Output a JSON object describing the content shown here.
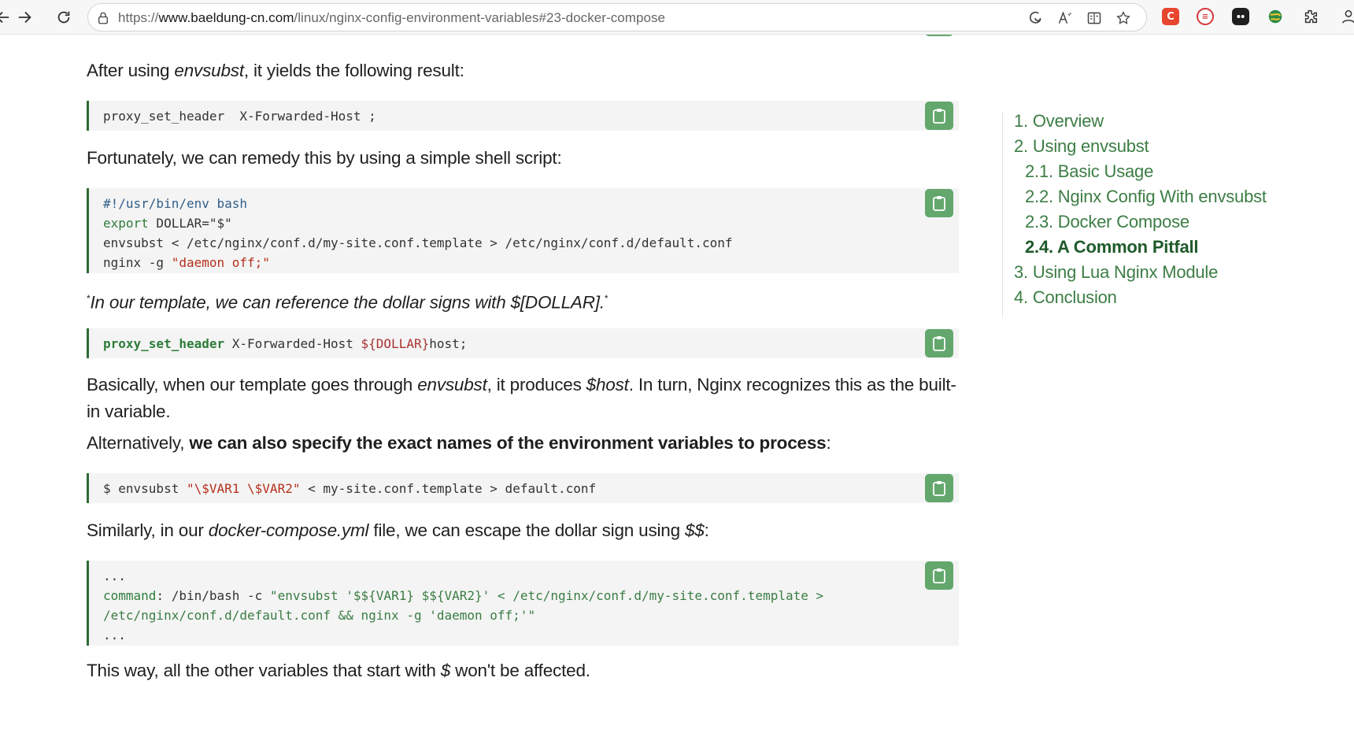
{
  "browser": {
    "url_host_prefix": "https://",
    "url_host": "www.baeldung-cn.com",
    "url_path": "/linux/nginx-config-environment-variables#23-docker-compose"
  },
  "article": {
    "p1": {
      "before": "After using ",
      "em": "envsubst",
      "after": ", it yields the following result:"
    },
    "code1": [
      "proxy_set_header  X-Forwarded-Host ;"
    ],
    "p2": "Fortunately, we can remedy this by using a simple shell script:",
    "code2": {
      "line1": "#!/usr/bin/env bash",
      "line2_kw": "export",
      "line2_rest": " DOLLAR=\"$\"",
      "line3": "envsubst < /etc/nginx/conf.d/my-site.conf.template > /etc/nginx/conf.d/default.conf",
      "line4_a": "nginx -g ",
      "line4_str": "\"daemon off;\""
    },
    "p3": {
      "mark": "*",
      "text": "In our template, we can reference the dollar signs with $[DOLLAR].",
      "end": "*"
    },
    "code3": {
      "kw": "proxy_set_header",
      "mid": " X-Forwarded-Host ",
      "var": "${DOLLAR}",
      "end": "host;"
    },
    "p4": {
      "a": "Basically, when our template goes through ",
      "em1": "envsubst",
      "b": ", it produces ",
      "em2": "$host",
      "c": ". In turn, Nginx recognizes this as the built-in variable."
    },
    "p5": {
      "a": "Alternatively, ",
      "b": "we can also specify the exact names of the environment variables to process",
      "c": ":"
    },
    "code4": {
      "a": "$ envsubst ",
      "str": "\"\\$VAR1 \\$VAR2\"",
      "b": " < my-site.conf.template > default.conf"
    },
    "p6": {
      "a": "Similarly, in our ",
      "em1": "docker-compose.yml",
      "b": " file, we can escape the dollar sign using ",
      "em2": "$$",
      "c": ":"
    },
    "code5": {
      "line1": "...",
      "line2_kw": "command",
      "line2_a": ": /bin/bash -c ",
      "line2_str": "\"envsubst '$${VAR1} $${VAR2}' < /etc/nginx/conf.d/my-site.conf.template >",
      "line3_str": "/etc/nginx/conf.d/default.conf && nginx -g 'daemon off;'\"",
      "line4": "..."
    },
    "p7": {
      "a": "This way, all the other variables that start with ",
      "em": "$",
      "b": " won't be affected."
    }
  },
  "toc": {
    "items": [
      {
        "label": "1. Overview"
      },
      {
        "label": "2. Using envsubst"
      },
      {
        "label": "2.1. Basic Usage"
      },
      {
        "label": "2.2. Nginx Config With envsubst"
      },
      {
        "label": "2.3. Docker Compose"
      },
      {
        "label": "2.4. A Common Pitfall"
      },
      {
        "label": "3. Using Lua Nginx Module"
      },
      {
        "label": "4. Conclusion"
      }
    ],
    "active_index": 5
  },
  "colors": {
    "accent_green": "#3c7d44",
    "copy_button": "#63a76d",
    "code_bg": "#f4f4f4",
    "code_border": "#2f6b35"
  },
  "icons": [
    "back-arrow-icon",
    "forward-arrow-icon",
    "reload-icon",
    "lock-icon",
    "edge-sidebar-icon",
    "read-aloud-icon",
    "immersive-reader-icon",
    "favorite-star-icon",
    "extensions-puzzle-icon",
    "clipboard-icon"
  ]
}
